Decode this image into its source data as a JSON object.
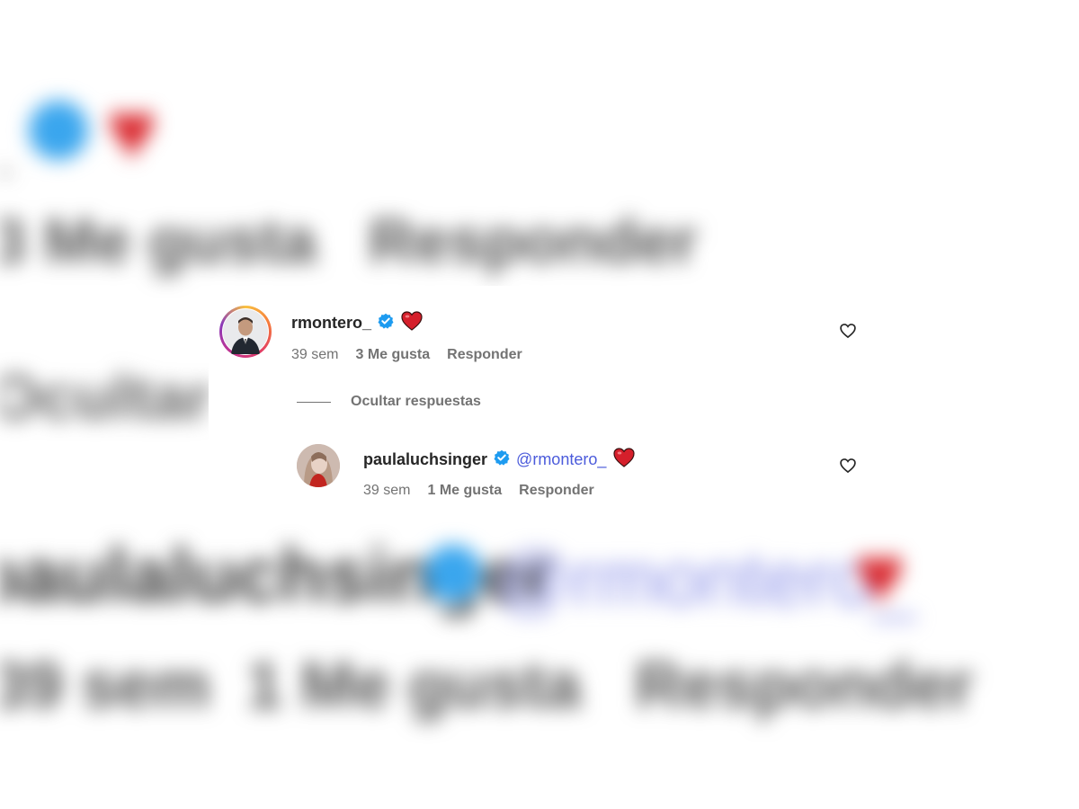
{
  "comment": {
    "username": "rmontero_",
    "verified": true,
    "emoji": "❤️",
    "time": "39 sem",
    "likes_label": "3 Me gusta",
    "reply_label": "Responder",
    "like_icon": "heart-outline-icon"
  },
  "hide_replies_label": "Ocultar respuestas",
  "reply": {
    "username": "paulaluchsinger",
    "verified": true,
    "mention": "@rmontero_",
    "emoji": "❤️",
    "time": "39 sem",
    "likes_label": "1 Me gusta",
    "reply_label": "Responder",
    "like_icon": "heart-outline-icon"
  },
  "colors": {
    "verified": "#1d9bf0",
    "heart": "#d51f2b",
    "mention": "#4b5bdb",
    "meta_text": "#737373",
    "username_text": "#262626"
  }
}
